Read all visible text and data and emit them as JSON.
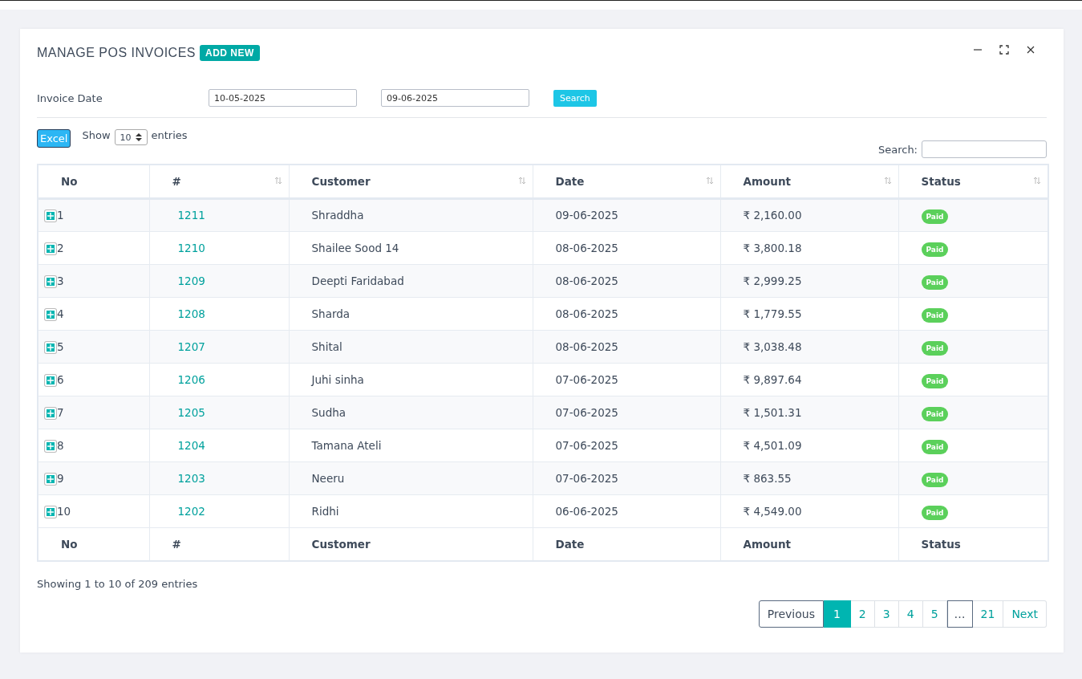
{
  "panel": {
    "title": "MANAGE POS INVOICES",
    "add_button": "ADD NEW"
  },
  "filter": {
    "label": "Invoice Date",
    "from": "10-05-2025",
    "to": "09-06-2025",
    "button": "Search"
  },
  "toolbar": {
    "excel": "Excel",
    "show": "Show",
    "page_size": "10",
    "entries": "entries",
    "search_label": "Search:"
  },
  "table": {
    "columns": [
      {
        "label": "No",
        "sortable": false
      },
      {
        "label": "#",
        "sortable": true
      },
      {
        "label": "Customer",
        "sortable": true
      },
      {
        "label": "Date",
        "sortable": true
      },
      {
        "label": "Amount",
        "sortable": true
      },
      {
        "label": "Status",
        "sortable": true
      }
    ],
    "rows": [
      {
        "no": "1",
        "id": "1211",
        "customer": "Shraddha",
        "date": "09-06-2025",
        "amount": "₹ 2,160.00",
        "status": "Paid"
      },
      {
        "no": "2",
        "id": "1210",
        "customer": "Shailee Sood 14",
        "date": "08-06-2025",
        "amount": "₹ 3,800.18",
        "status": "Paid"
      },
      {
        "no": "3",
        "id": "1209",
        "customer": "Deepti Faridabad",
        "date": "08-06-2025",
        "amount": "₹ 2,999.25",
        "status": "Paid"
      },
      {
        "no": "4",
        "id": "1208",
        "customer": "Sharda",
        "date": "08-06-2025",
        "amount": "₹ 1,779.55",
        "status": "Paid"
      },
      {
        "no": "5",
        "id": "1207",
        "customer": "Shital",
        "date": "08-06-2025",
        "amount": "₹ 3,038.48",
        "status": "Paid"
      },
      {
        "no": "6",
        "id": "1206",
        "customer": "Juhi sinha",
        "date": "07-06-2025",
        "amount": "₹ 9,897.64",
        "status": "Paid"
      },
      {
        "no": "7",
        "id": "1205",
        "customer": "Sudha",
        "date": "07-06-2025",
        "amount": "₹ 1,501.31",
        "status": "Paid"
      },
      {
        "no": "8",
        "id": "1204",
        "customer": "Tamana Ateli",
        "date": "07-06-2025",
        "amount": "₹ 4,501.09",
        "status": "Paid"
      },
      {
        "no": "9",
        "id": "1203",
        "customer": "Neeru",
        "date": "07-06-2025",
        "amount": "₹ 863.55",
        "status": "Paid"
      },
      {
        "no": "10",
        "id": "1202",
        "customer": "Ridhi",
        "date": "06-06-2025",
        "amount": "₹ 4,549.00",
        "status": "Paid"
      }
    ],
    "footer": [
      "No",
      "#",
      "Customer",
      "Date",
      "Amount",
      "Status"
    ]
  },
  "info": "Showing 1 to 10 of 209 entries",
  "pagination": [
    {
      "label": "Previous",
      "kind": "nav",
      "selected": false
    },
    {
      "label": "1",
      "kind": "page",
      "selected": true
    },
    {
      "label": "2",
      "kind": "page",
      "selected": false
    },
    {
      "label": "3",
      "kind": "page",
      "selected": false
    },
    {
      "label": "4",
      "kind": "page",
      "selected": false
    },
    {
      "label": "5",
      "kind": "page",
      "selected": false
    },
    {
      "label": "…",
      "kind": "gap",
      "selected": false
    },
    {
      "label": "21",
      "kind": "page",
      "selected": false
    },
    {
      "label": "Next",
      "kind": "nav",
      "selected": false
    }
  ]
}
